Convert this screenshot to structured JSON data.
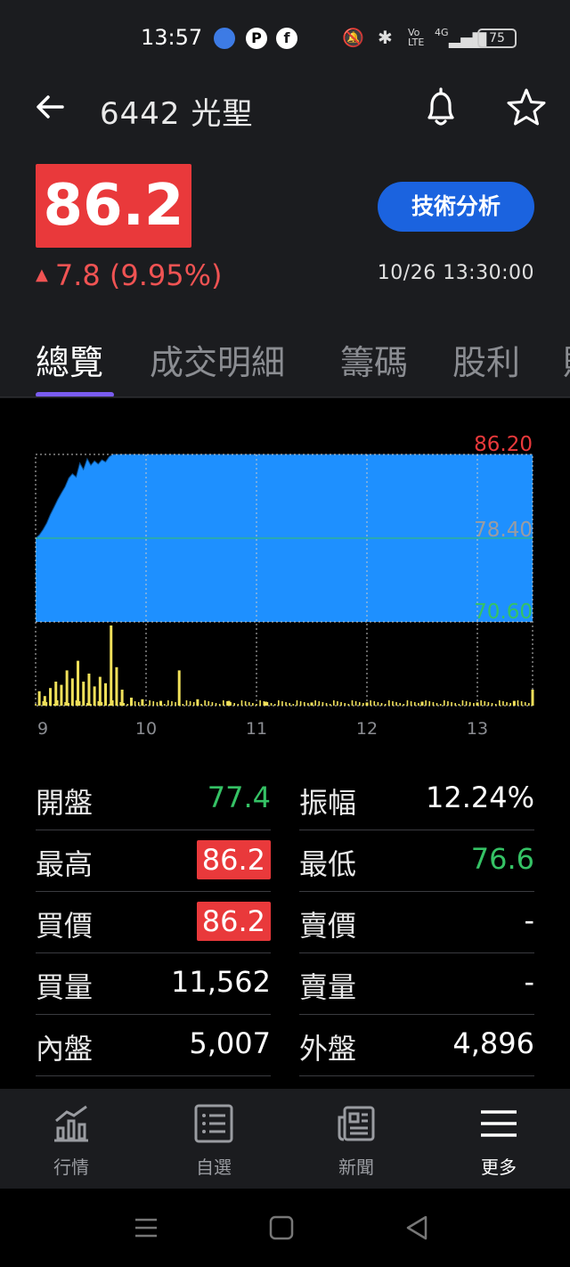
{
  "status_bar": {
    "time": "13:57",
    "network": "4G",
    "battery": "75"
  },
  "header": {
    "stock_code": "6442",
    "stock_name": "光聖",
    "title": "6442 光聖"
  },
  "quote": {
    "price": "86.2",
    "change_arrow": "▲",
    "change": "7.8 (9.95%)",
    "datetime": "10/26 13:30:00",
    "tech_button": "技術分析"
  },
  "tabs": [
    {
      "label": "總覽",
      "active": true
    },
    {
      "label": "成交明細",
      "active": false
    },
    {
      "label": "籌碼",
      "active": false
    },
    {
      "label": "股利",
      "active": false
    },
    {
      "label": "財",
      "active": false
    }
  ],
  "chart_data": {
    "type": "area",
    "ylim": [
      70.6,
      86.2
    ],
    "y_tick_labels": [
      "86.20",
      "78.40",
      "70.60"
    ],
    "x_tick_labels": [
      "9",
      "10",
      "11",
      "12",
      "13"
    ],
    "reference_price": 78.4,
    "colors": {
      "price_fill": "#1e90ff",
      "volume": "#f0e05a",
      "high_label": "#e9393b",
      "ref_label": "#9a9ca1",
      "low_label": "#35c265"
    },
    "price_series": [
      {
        "t": "09:00",
        "v": 78.4
      },
      {
        "t": "09:02",
        "v": 78.7
      },
      {
        "t": "09:04",
        "v": 79.2
      },
      {
        "t": "09:06",
        "v": 79.8
      },
      {
        "t": "09:08",
        "v": 80.6
      },
      {
        "t": "09:10",
        "v": 81.3
      },
      {
        "t": "09:12",
        "v": 82.0
      },
      {
        "t": "09:14",
        "v": 82.6
      },
      {
        "t": "09:16",
        "v": 83.2
      },
      {
        "t": "09:18",
        "v": 84.0
      },
      {
        "t": "09:20",
        "v": 84.4
      },
      {
        "t": "09:22",
        "v": 84.1
      },
      {
        "t": "09:24",
        "v": 85.4
      },
      {
        "t": "09:26",
        "v": 84.8
      },
      {
        "t": "09:28",
        "v": 85.8
      },
      {
        "t": "09:30",
        "v": 85.2
      },
      {
        "t": "09:32",
        "v": 85.6
      },
      {
        "t": "09:34",
        "v": 85.3
      },
      {
        "t": "09:36",
        "v": 85.7
      },
      {
        "t": "09:38",
        "v": 85.5
      },
      {
        "t": "09:40",
        "v": 86.0
      },
      {
        "t": "09:42",
        "v": 86.2
      },
      {
        "t": "13:30",
        "v": 86.2
      }
    ],
    "volume_series": [
      {
        "t": "09:02",
        "v": 18
      },
      {
        "t": "09:05",
        "v": 12
      },
      {
        "t": "09:08",
        "v": 22
      },
      {
        "t": "09:11",
        "v": 30
      },
      {
        "t": "09:14",
        "v": 26
      },
      {
        "t": "09:17",
        "v": 44
      },
      {
        "t": "09:20",
        "v": 34
      },
      {
        "t": "09:23",
        "v": 56
      },
      {
        "t": "09:26",
        "v": 30
      },
      {
        "t": "09:29",
        "v": 40
      },
      {
        "t": "09:32",
        "v": 24
      },
      {
        "t": "09:35",
        "v": 36
      },
      {
        "t": "09:38",
        "v": 28
      },
      {
        "t": "09:41",
        "v": 100
      },
      {
        "t": "09:44",
        "v": 48
      },
      {
        "t": "09:47",
        "v": 20
      },
      {
        "t": "09:52",
        "v": 10
      },
      {
        "t": "09:58",
        "v": 8
      },
      {
        "t": "10:08",
        "v": 6
      },
      {
        "t": "10:18",
        "v": 44
      },
      {
        "t": "10:28",
        "v": 8
      },
      {
        "t": "10:45",
        "v": 6
      },
      {
        "t": "11:05",
        "v": 5
      },
      {
        "t": "11:30",
        "v": 4
      },
      {
        "t": "12:00",
        "v": 4
      },
      {
        "t": "12:30",
        "v": 5
      },
      {
        "t": "13:00",
        "v": 4
      },
      {
        "t": "13:20",
        "v": 6
      },
      {
        "t": "13:30",
        "v": 20
      }
    ]
  },
  "stats": [
    {
      "label": "開盤",
      "value": "77.4",
      "style": "green"
    },
    {
      "label": "振幅",
      "value": "12.24%",
      "style": "plain"
    },
    {
      "label": "最高",
      "value": "86.2",
      "style": "up-box"
    },
    {
      "label": "最低",
      "value": "76.6",
      "style": "green"
    },
    {
      "label": "買價",
      "value": "86.2",
      "style": "up-box"
    },
    {
      "label": "賣價",
      "value": "-",
      "style": "plain"
    },
    {
      "label": "買量",
      "value": "11,562",
      "style": "plain"
    },
    {
      "label": "賣量",
      "value": "-",
      "style": "plain"
    },
    {
      "label": "內盤",
      "value": "5,007",
      "style": "plain"
    },
    {
      "label": "外盤",
      "value": "4,896",
      "style": "plain"
    }
  ],
  "bottom_nav": [
    {
      "label": "行情",
      "icon": "chart-icon",
      "active": false
    },
    {
      "label": "自選",
      "icon": "list-icon",
      "active": false
    },
    {
      "label": "新聞",
      "icon": "news-icon",
      "active": false
    },
    {
      "label": "更多",
      "icon": "menu-icon",
      "active": true
    }
  ]
}
